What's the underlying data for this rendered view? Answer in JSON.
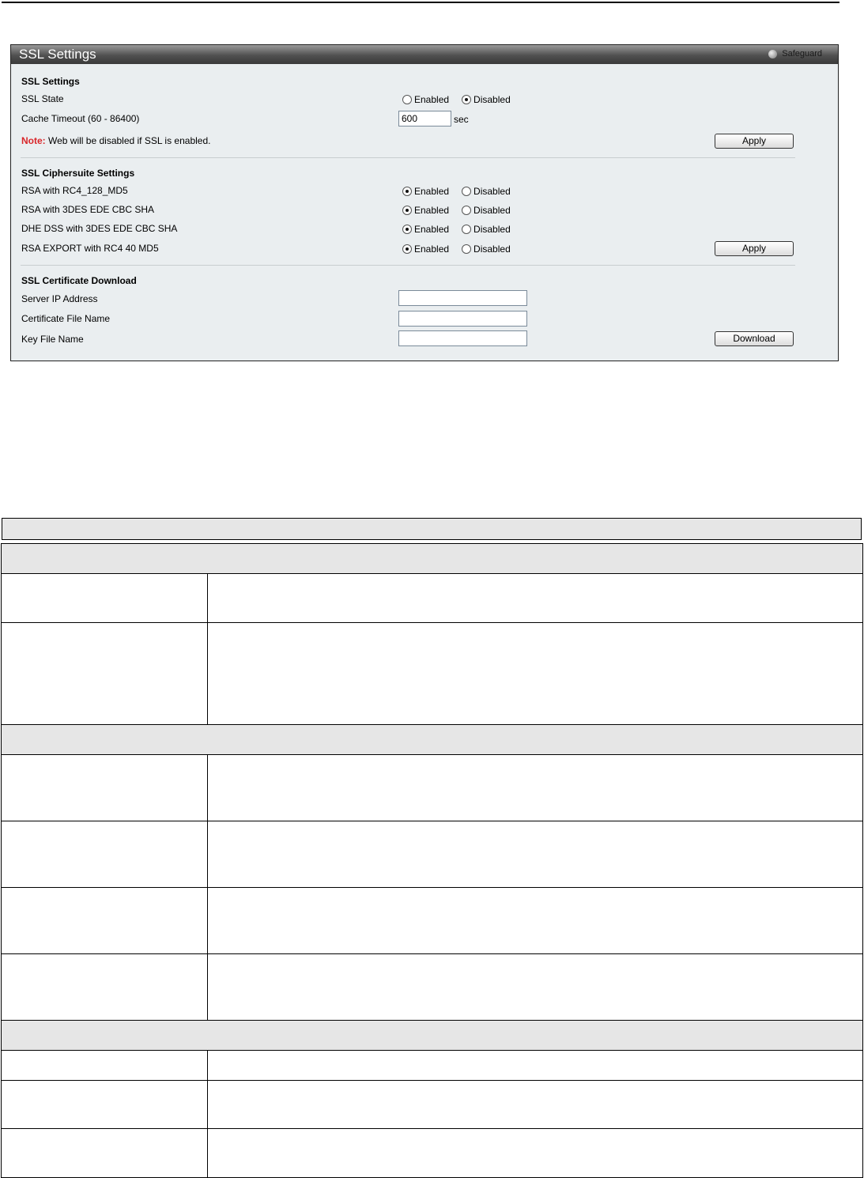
{
  "panel": {
    "title": "SSL Settings",
    "safeguard": "Safeguard"
  },
  "ssl_settings": {
    "heading": "SSL Settings",
    "state_label": "SSL State",
    "state_selected": "Disabled",
    "cache_label": "Cache Timeout (60 - 86400)",
    "cache_value": "600",
    "cache_unit": "sec",
    "note_prefix": "Note:",
    "note_text": " Web will be disabled if SSL is enabled.",
    "apply_label": "Apply"
  },
  "radio_labels": {
    "enabled": "Enabled",
    "disabled": "Disabled"
  },
  "ciphersuite": {
    "heading": "SSL Ciphersuite Settings",
    "rows": [
      {
        "label": "RSA with RC4_128_MD5",
        "selected": "Enabled"
      },
      {
        "label": "RSA with 3DES EDE CBC SHA",
        "selected": "Enabled"
      },
      {
        "label": "DHE DSS with 3DES EDE CBC SHA",
        "selected": "Enabled"
      },
      {
        "label": "RSA EXPORT with RC4 40 MD5",
        "selected": "Enabled"
      }
    ],
    "apply_label": "Apply"
  },
  "certificate": {
    "heading": "SSL Certificate Download",
    "server_ip_label": "Server IP Address",
    "server_ip_value": "",
    "cert_file_label": "Certificate File Name",
    "cert_file_value": "",
    "key_file_label": "Key File Name",
    "key_file_value": "",
    "download_label": "Download"
  }
}
